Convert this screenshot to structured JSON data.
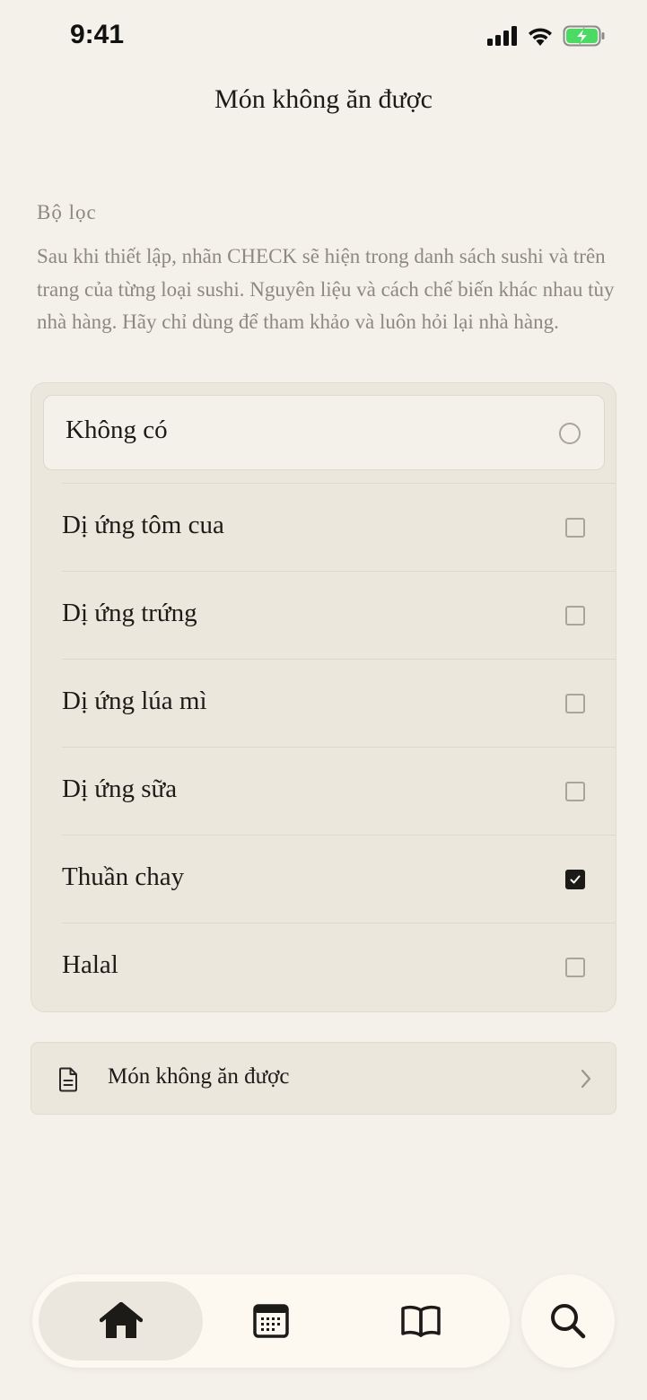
{
  "status_bar": {
    "time": "9:41"
  },
  "header": {
    "title": "Món không ăn được"
  },
  "filter": {
    "label": "Bộ lọc",
    "description": "Sau khi thiết lập, nhãn CHECK sẽ hiện trong danh sách sushi và trên trang của từng loại sushi. Nguyên liệu và cách chế biến khác nhau tùy nhà hàng. Hãy chỉ dùng để tham khảo và luôn hỏi lại nhà hàng.",
    "none_option": {
      "label": "Không có",
      "selected": false
    },
    "options": [
      {
        "label": "Dị ứng tôm cua",
        "checked": false
      },
      {
        "label": "Dị ứng trứng",
        "checked": false
      },
      {
        "label": "Dị ứng lúa mì",
        "checked": false
      },
      {
        "label": "Dị ứng sữa",
        "checked": false
      },
      {
        "label": "Thuần chay",
        "checked": true
      },
      {
        "label": "Halal",
        "checked": false
      }
    ]
  },
  "link": {
    "label": "Món không ăn được",
    "icon": "document-icon"
  },
  "tab_bar": {
    "tabs": [
      {
        "icon": "home-icon",
        "active": true
      },
      {
        "icon": "calendar-icon",
        "active": false
      },
      {
        "icon": "book-icon",
        "active": false
      }
    ],
    "search_icon": "search-icon"
  },
  "colors": {
    "background": "#f4f1ea",
    "card": "#ebe7dd",
    "muted_text": "#8d8880",
    "text": "#1d1b18",
    "battery_green": "#4cd964"
  }
}
